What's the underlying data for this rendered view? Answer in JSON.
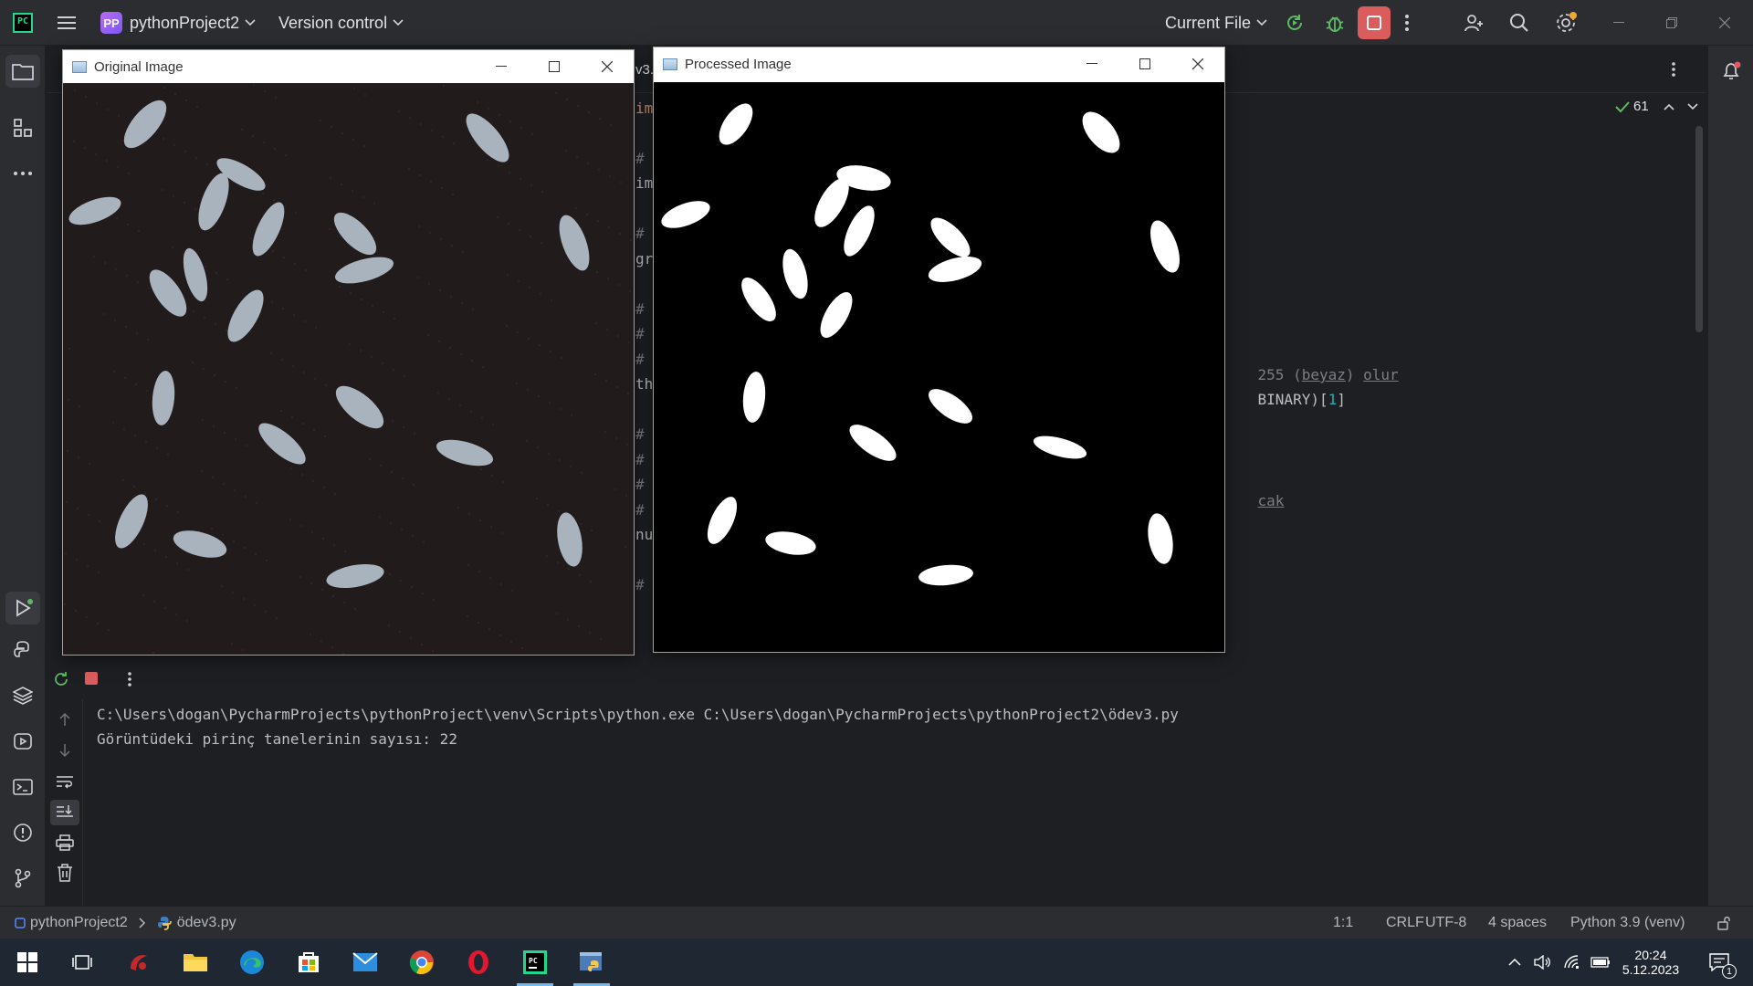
{
  "titlebar": {
    "project_badge": "PP",
    "project_name": "pythonProject2",
    "vcs_label": "Version control",
    "run_config": "Current File"
  },
  "editor": {
    "tab_fragment": "v3.",
    "inspection_count": "61",
    "lines": [
      {
        "text": "im",
        "cls": "kw"
      },
      {
        "text": "#",
        "cls": "cmt"
      },
      {
        "text": "im",
        "cls": ""
      },
      {
        "text": "#",
        "cls": "cmt"
      },
      {
        "text": "gr",
        "cls": ""
      },
      {
        "text": "#",
        "cls": "cmt"
      },
      {
        "text": "#",
        "cls": "cmt"
      },
      {
        "text": "#",
        "cls": "cmt"
      },
      {
        "text": "th",
        "cls": ""
      },
      {
        "text": "#",
        "cls": "cmt"
      },
      {
        "text": "#",
        "cls": "cmt"
      },
      {
        "text": "#",
        "cls": "cmt"
      },
      {
        "text": "#",
        "cls": "cmt"
      },
      {
        "text": "nu",
        "cls": ""
      },
      {
        "text": "#",
        "cls": "cmt"
      }
    ],
    "right_fragments": {
      "line1_a": "255 (",
      "line1_b": "beyaz",
      "line1_c": ") ",
      "line1_d": "olur",
      "line2_a": "BINARY)[",
      "line2_b": "1",
      "line2_c": "]",
      "line3": "cak"
    }
  },
  "windows": {
    "original": {
      "title": "Original Image"
    },
    "processed": {
      "title": "Processed Image"
    }
  },
  "console": {
    "command": "C:\\Users\\dogan\\PycharmProjects\\pythonProject\\venv\\Scripts\\python.exe C:\\Users\\dogan\\PycharmProjects\\pythonProject2\\ödev3.py",
    "output": "Görüntüdeki pirinç tanelerinin sayısı: 22"
  },
  "statusbar": {
    "project": "pythonProject2",
    "file": "ödev3.py",
    "position": "1:1",
    "line_sep": "CRLF",
    "encoding": "UTF-8",
    "indent": "4 spaces",
    "interpreter": "Python 3.9 (venv)"
  },
  "taskbar": {
    "time": "20:24",
    "date": "5.12.2023",
    "notif_count": "1",
    "apps": [
      "start",
      "task-view",
      "app-red",
      "file-explorer",
      "edge",
      "store",
      "mail",
      "chrome",
      "opera",
      "pycharm",
      "python"
    ]
  },
  "colors": {
    "accent": "#21d789",
    "stop": "#db5c5c",
    "taskbar": "#1f2832"
  }
}
